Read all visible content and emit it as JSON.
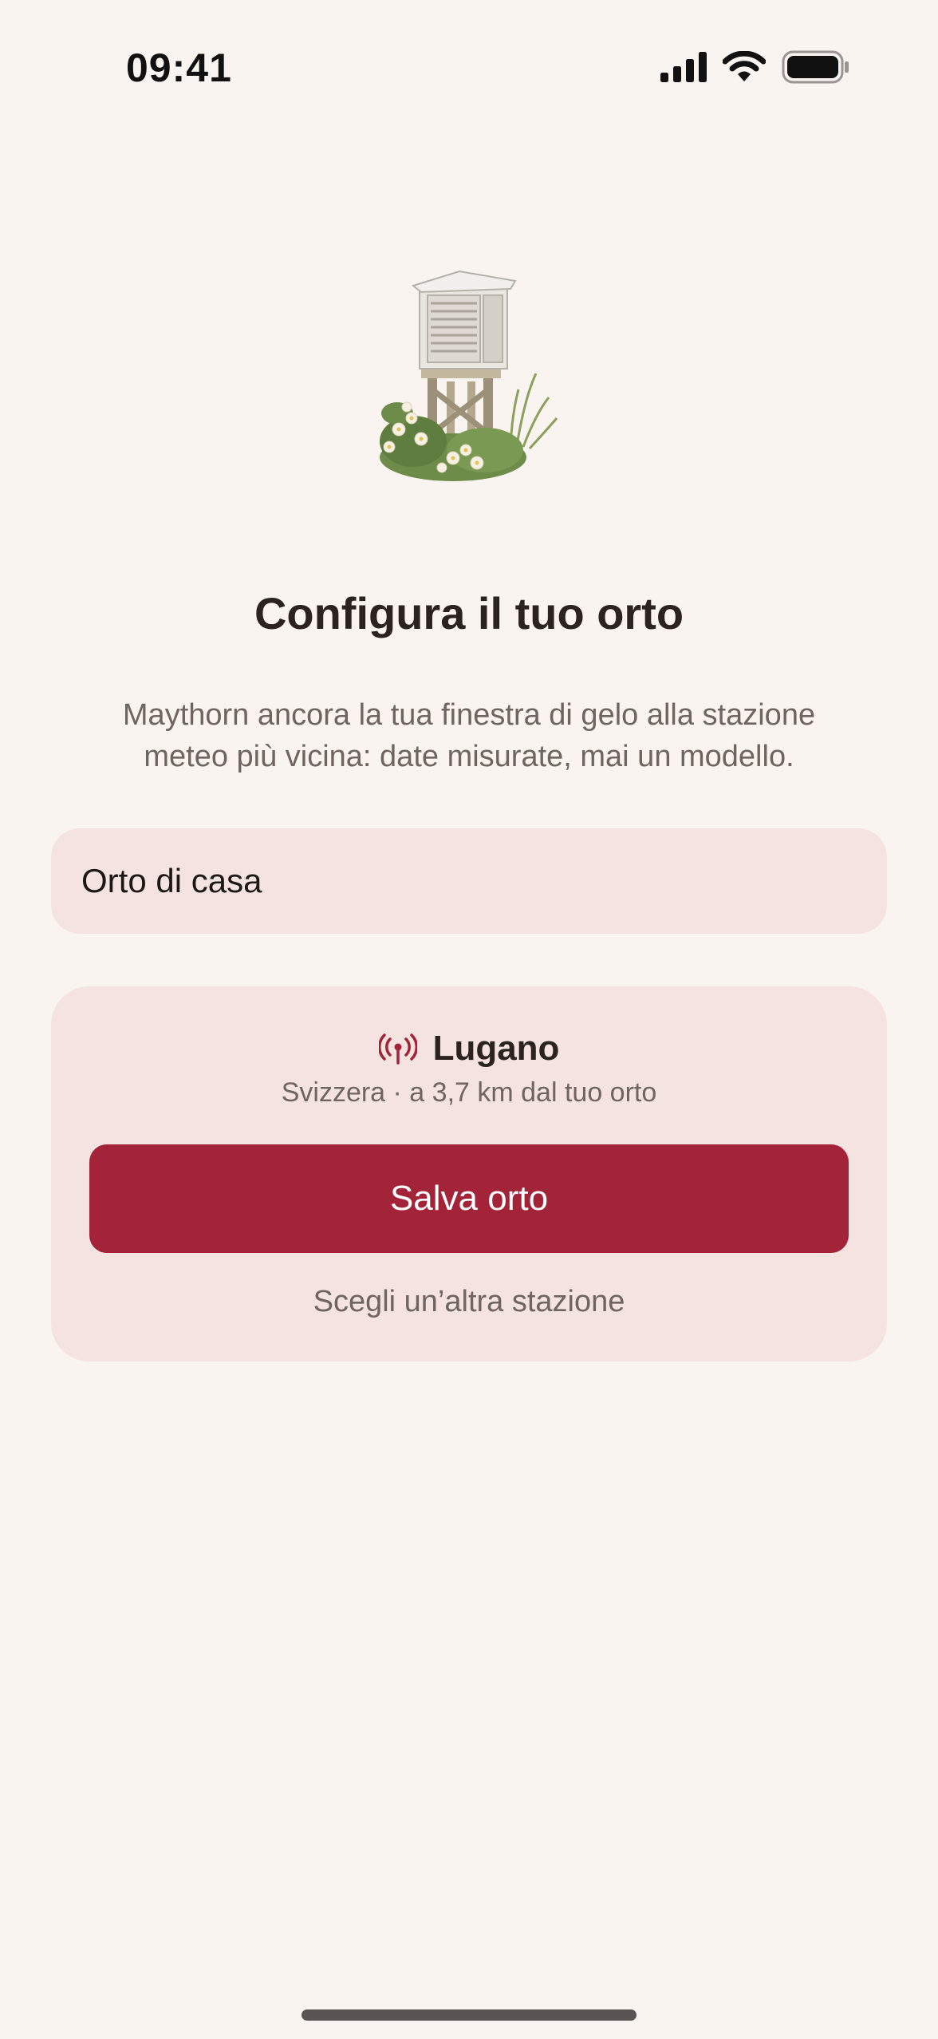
{
  "status_bar": {
    "time": "09:41",
    "icons": [
      "cellular-signal-icon",
      "wifi-icon",
      "battery-icon"
    ]
  },
  "hero": {
    "icon": "weather-station-illustration"
  },
  "title": "Configura il tuo orto",
  "subtitle": "Maythorn ancora la tua finestra di gelo alla stazione meteo più vicina: date misurate, mai un modello.",
  "garden_name_field": {
    "value": "Orto di casa"
  },
  "station": {
    "icon": "antenna-signal-icon",
    "name": "Lugano",
    "meta": "Svizzera · a 3,7 km dal tuo orto"
  },
  "actions": {
    "save_label": "Salva orto",
    "other_station_label": "Scegli un’altra stazione"
  },
  "colors": {
    "background": "#f9f4ef",
    "card": "#f4e3e1",
    "accent": "#a32338",
    "muted_text": "#6e6460"
  }
}
